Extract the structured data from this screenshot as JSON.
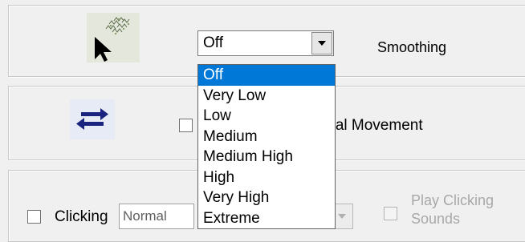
{
  "smoothing": {
    "label": "Smoothing",
    "icon": "cursor-trail-icon",
    "selected": "Off",
    "options": [
      "Off",
      "Very Low",
      "Low",
      "Medium",
      "Medium High",
      "High",
      "Very High",
      "Extreme"
    ]
  },
  "horizontal": {
    "icon": "swap-arrows-icon",
    "label_visible": "ntal Movement",
    "checked": false
  },
  "clicking": {
    "label": "Clicking",
    "mode": "Normal",
    "checked": false,
    "sounds_label": "Play Clicking Sounds",
    "sounds_enabled": false
  },
  "colors": {
    "highlight": "#0078d7",
    "swap_icon": "#1a237e",
    "disabled_text": "#a8a8a8"
  }
}
